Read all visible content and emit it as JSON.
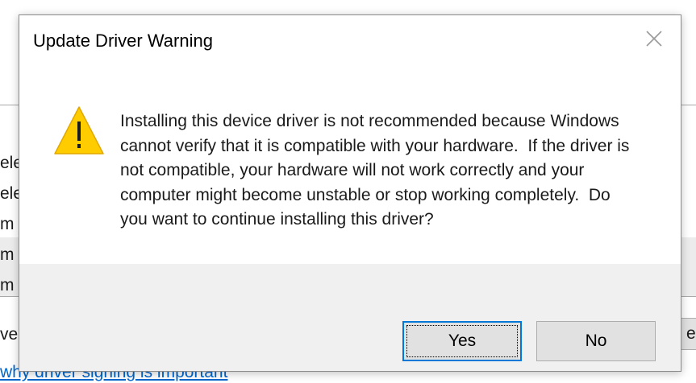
{
  "background": {
    "row_fragments": [
      "ele",
      "ele",
      "m",
      "m",
      "m"
    ],
    "left_fragment": "ver",
    "link_text": "why driver signing is important",
    "right_button_fragment": "e D"
  },
  "dialog": {
    "title": "Update Driver Warning",
    "close_icon": "close-icon",
    "warning_icon": "warning-icon",
    "message_lines": [
      "Installing this device driver is not recommended because Windows",
      "cannot verify that it is compatible with your hardware.  If the driver is",
      "not compatible, your hardware will not work correctly and your",
      "computer might become unstable or stop working completely.  Do",
      "you want to continue installing this driver?"
    ],
    "buttons": {
      "yes_label": "Yes",
      "no_label": "No"
    }
  },
  "colors": {
    "focus_border": "#0078d7",
    "footer_bg": "#f0f0f0",
    "button_bg": "#e1e1e1",
    "warning_yellow": "#ffcc00",
    "link_blue": "#0066cc"
  }
}
